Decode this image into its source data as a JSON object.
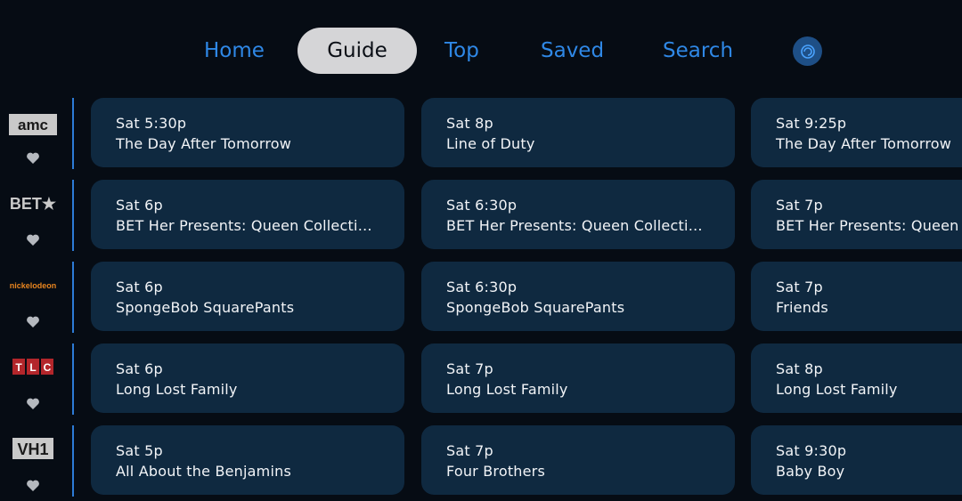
{
  "nav": {
    "items": [
      {
        "label": "Home"
      },
      {
        "label": "Guide"
      },
      {
        "label": "Top"
      },
      {
        "label": "Saved"
      },
      {
        "label": "Search"
      }
    ],
    "active": "Guide",
    "profile_icon": "profile-avatar-icon"
  },
  "colors": {
    "background": "#060c14",
    "card": "#0f2940",
    "nav_text": "#2f88e6",
    "active_tab_bg": "#d5d5d7",
    "divider": "#2d7bd6"
  },
  "channels": [
    {
      "logo": "amc",
      "favorite_icon": "heart-icon",
      "programs": [
        {
          "time": "Sat 5:30p",
          "title": "The Day After Tomorrow"
        },
        {
          "time": "Sat 8p",
          "title": "Line of Duty"
        },
        {
          "time": "Sat 9:25p",
          "title": "The Day After Tomorrow"
        }
      ]
    },
    {
      "logo": "BET★",
      "favorite_icon": "heart-icon",
      "programs": [
        {
          "time": "Sat 6p",
          "title": "BET Her Presents: Queen Collecti…"
        },
        {
          "time": "Sat 6:30p",
          "title": "BET Her Presents: Queen Collecti…"
        },
        {
          "time": "Sat 7p",
          "title": "BET Her Presents: Queen"
        }
      ]
    },
    {
      "logo": "nickelodeon",
      "favorite_icon": "heart-icon",
      "programs": [
        {
          "time": "Sat 6p",
          "title": "SpongeBob SquarePants"
        },
        {
          "time": "Sat 6:30p",
          "title": "SpongeBob SquarePants"
        },
        {
          "time": "Sat 7p",
          "title": "Friends"
        }
      ]
    },
    {
      "logo": "TLC",
      "favorite_icon": "heart-icon",
      "programs": [
        {
          "time": "Sat 6p",
          "title": "Long Lost Family"
        },
        {
          "time": "Sat 7p",
          "title": "Long Lost Family"
        },
        {
          "time": "Sat 8p",
          "title": "Long Lost Family"
        }
      ]
    },
    {
      "logo": "VH1",
      "favorite_icon": "heart-icon",
      "programs": [
        {
          "time": "Sat 5p",
          "title": "All About the Benjamins"
        },
        {
          "time": "Sat 7p",
          "title": "Four Brothers"
        },
        {
          "time": "Sat 9:30p",
          "title": "Baby Boy"
        }
      ]
    }
  ]
}
